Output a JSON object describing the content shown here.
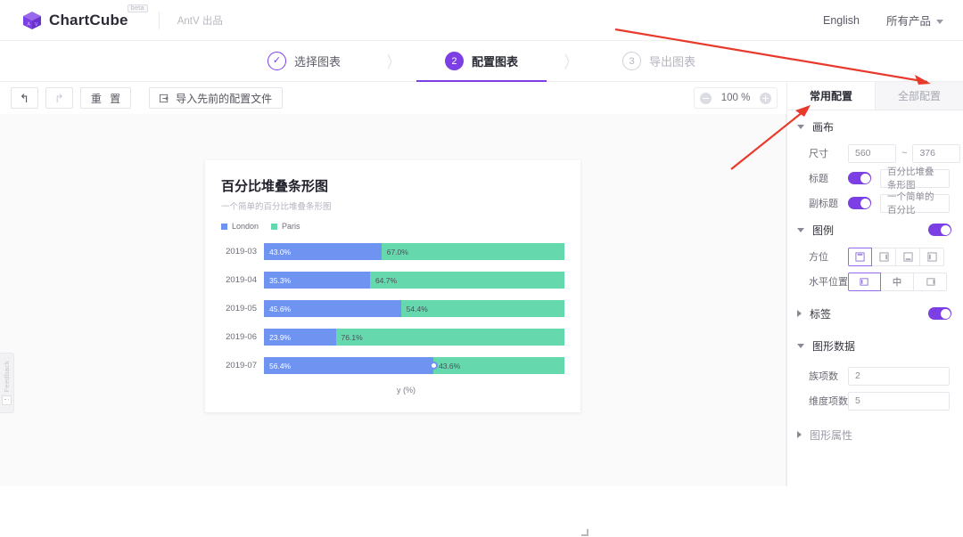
{
  "header": {
    "brand": "ChartCube",
    "beta": "beta",
    "byline": "AntV 出品",
    "lang_link": "English",
    "products_link": "所有产品"
  },
  "steps": [
    {
      "num": "✓",
      "label": "选择图表",
      "state": "done"
    },
    {
      "num": "2",
      "label": "配置图表",
      "state": "active"
    },
    {
      "num": "3",
      "label": "导出图表",
      "state": "todo"
    }
  ],
  "step_sep": "〉",
  "toolbar": {
    "undo": "↰",
    "redo": "↱",
    "reset": "重 置",
    "import": "导入先前的配置文件",
    "zoom_value": "100 %"
  },
  "chart_data": {
    "type": "bar",
    "title": "百分比堆叠条形图",
    "subtitle": "一个简单的百分比堆叠条形图",
    "xlabel": "y (%)",
    "ylabel": "",
    "orientation": "horizontal",
    "stacked": "percent",
    "legend": [
      {
        "name": "London",
        "color": "#6e93f0"
      },
      {
        "name": "Paris",
        "color": "#66d8ae"
      }
    ],
    "categories": [
      "2019-03",
      "2019-04",
      "2019-05",
      "2019-06",
      "2019-07"
    ],
    "series": [
      {
        "name": "London",
        "color": "#6e93f0",
        "values": [
          43.0,
          35.3,
          45.6,
          23.9,
          56.4
        ],
        "labels": [
          "43.0%",
          "35.3%",
          "45.6%",
          "23.9%",
          "56.4%"
        ]
      },
      {
        "name": "Paris",
        "color": "#66d8ae",
        "values": [
          67.0,
          64.7,
          54.4,
          76.1,
          43.6
        ],
        "labels": [
          "67.0%",
          "64.7%",
          "54.4%",
          "76.1%",
          "43.6%"
        ]
      }
    ],
    "xlim": [
      0,
      100
    ],
    "grid": false,
    "legend_position": "top-left",
    "active_handle_row": "2019-07"
  },
  "panel": {
    "tabs": [
      {
        "label": "常用配置",
        "active": true
      },
      {
        "label": "全部配置",
        "active": false
      }
    ],
    "canvas": {
      "title": "画布",
      "size_label": "尺寸",
      "width": "560",
      "height": "376",
      "dash": "~",
      "title_row_label": "标题",
      "title_value": "百分比堆叠条形图",
      "subtitle_row_label": "副标题",
      "subtitle_value": "一个简单的百分比"
    },
    "legend": {
      "title": "图例",
      "orientation_label": "方位",
      "orientation_options": [
        "top",
        "right",
        "bottom",
        "left"
      ],
      "orientation_selected": 0,
      "align_label": "水平位置",
      "align_options": [
        "左",
        "中",
        "右"
      ],
      "align_selected": 0
    },
    "label_section": {
      "title": "标签"
    },
    "graph_data": {
      "title": "图形数据",
      "series_count_label": "族项数",
      "series_count": "2",
      "dim_count_label": "维度项数",
      "dim_count": "5"
    },
    "graph_props": {
      "title": "图形属性"
    }
  },
  "feedback": {
    "label": "Feedback"
  }
}
